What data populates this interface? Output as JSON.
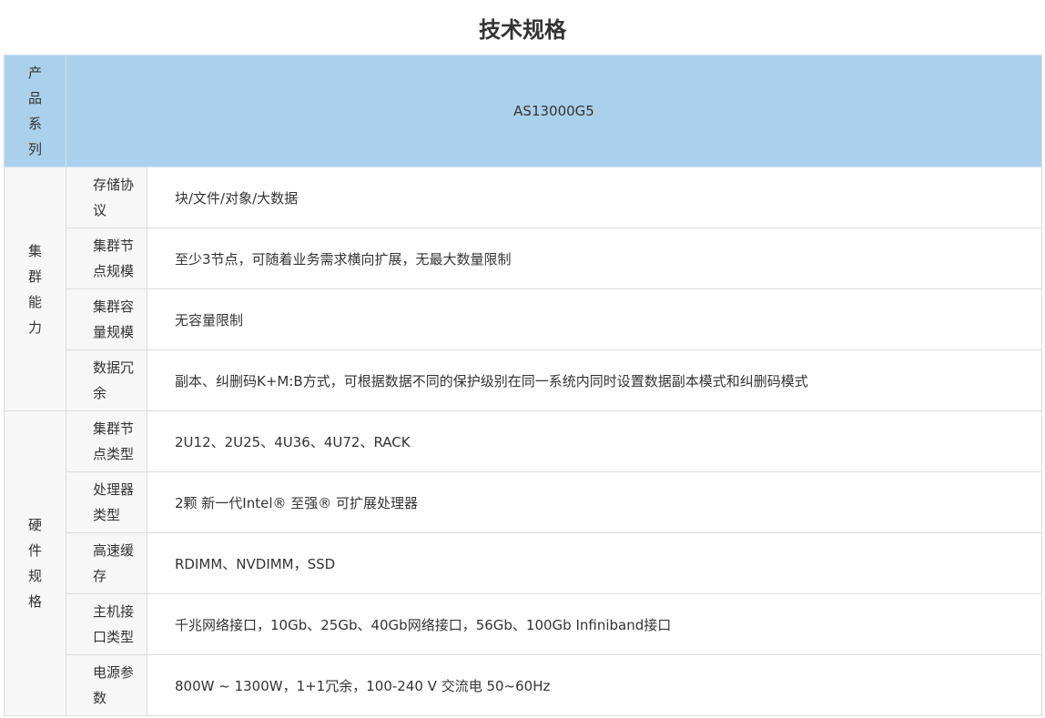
{
  "title": "技术规格",
  "header": {
    "label_chars": [
      "产",
      "品",
      "系",
      "列"
    ],
    "value": "AS13000G5"
  },
  "groups": [
    {
      "label_chars": [
        "集",
        "群",
        "能",
        "力"
      ],
      "rows": [
        {
          "label": "存储协议",
          "value": "块/文件/对象/大数据"
        },
        {
          "label": "集群节点规模",
          "value": "至少3节点，可随着业务需求横向扩展，无最大数量限制"
        },
        {
          "label": "集群容量规模",
          "value": "无容量限制"
        },
        {
          "label": "数据冗余",
          "value": "副本、纠删码K+M:B方式，可根据数据不同的保护级别在同一系统内同时设置数据副本模式和纠删码模式"
        }
      ]
    },
    {
      "label_chars": [
        "硬",
        "件",
        "规",
        "格"
      ],
      "rows": [
        {
          "label": "集群节点类型",
          "value": "2U12、2U25、4U36、4U72、RACK"
        },
        {
          "label": "处理器类型",
          "value": "2颗 新一代Intel® 至强® 可扩展处理器"
        },
        {
          "label": "高速缓存",
          "value": "RDIMM、NVDIMM，SSD"
        },
        {
          "label": "主机接口类型",
          "value": "千兆网络接口，10Gb、25Gb、40Gb网络接口，56Gb、100Gb Infiniband接口"
        },
        {
          "label": "电源参数",
          "value": "800W ~ 1300W，1+1冗余，100-240 V 交流电 50~60Hz"
        }
      ]
    }
  ]
}
